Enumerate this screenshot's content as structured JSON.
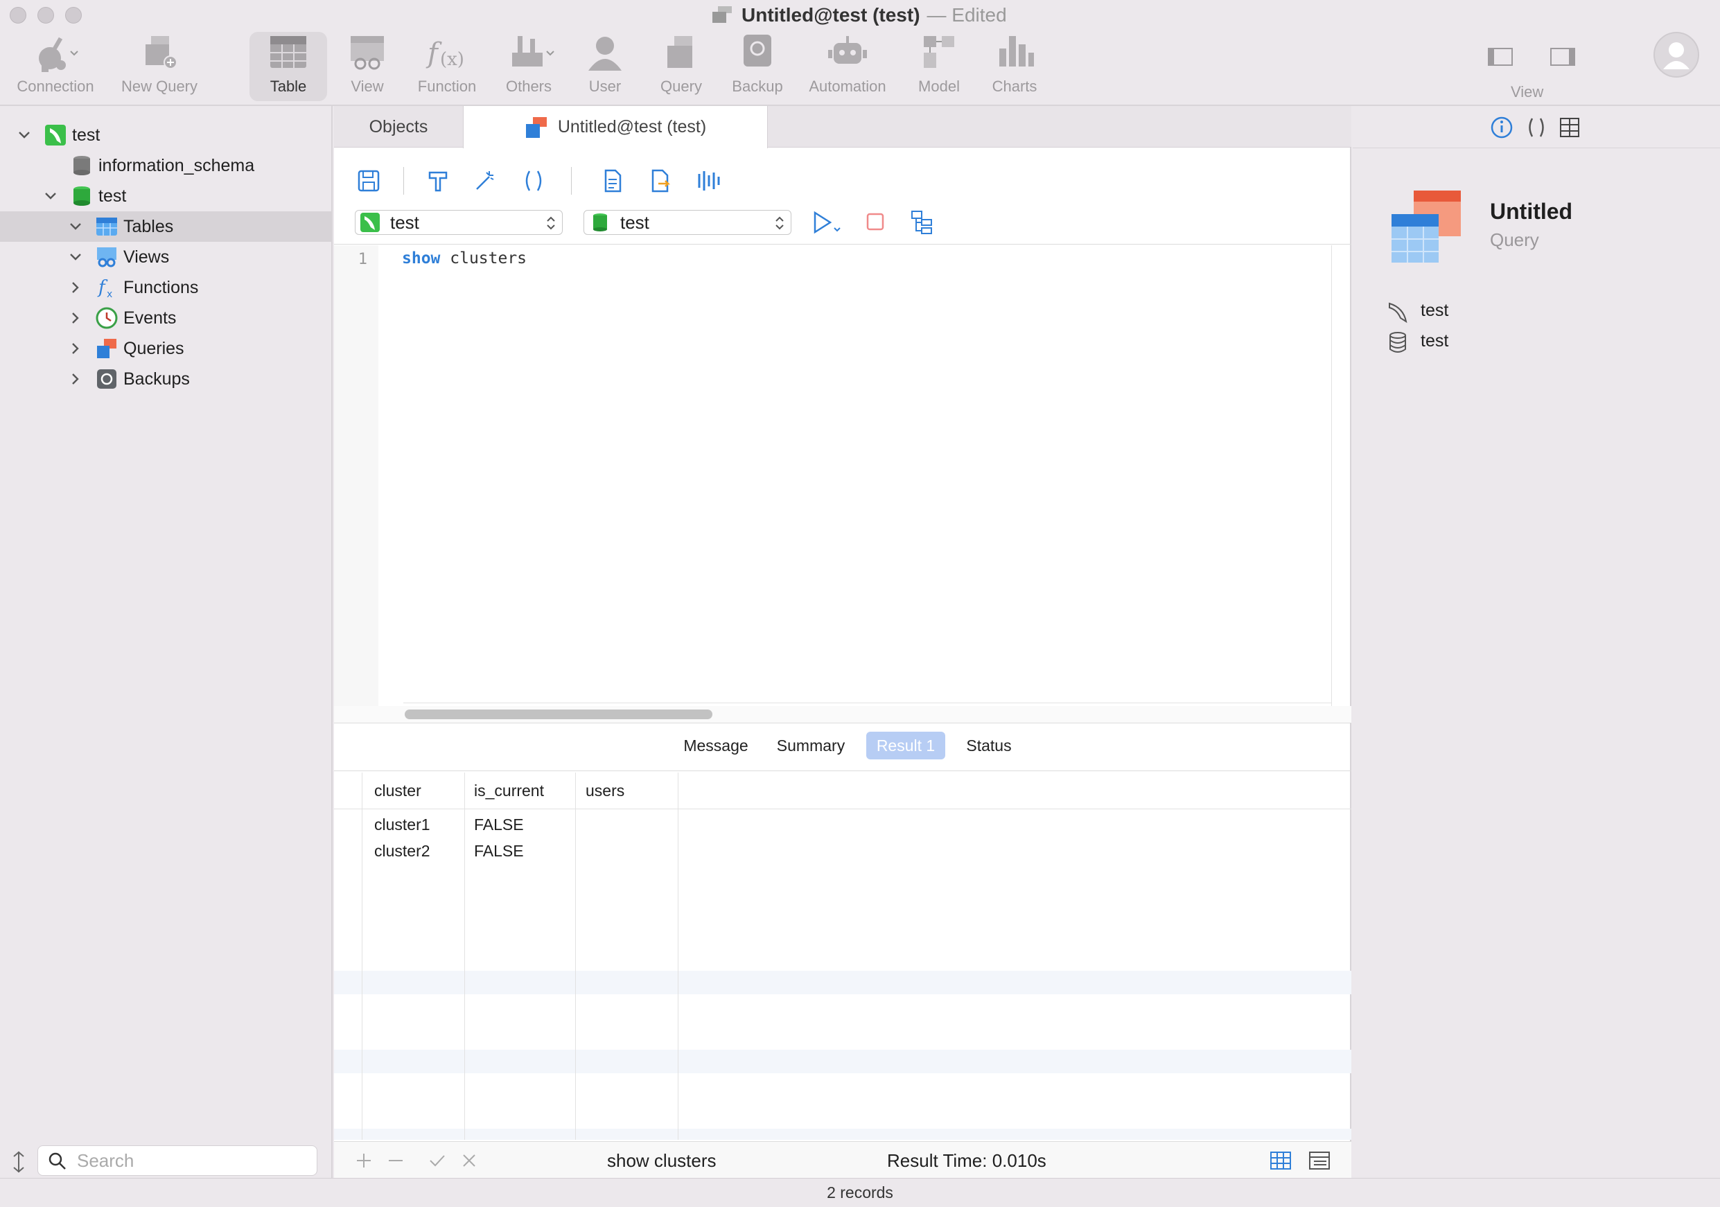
{
  "window": {
    "title": "Untitled@test (test)",
    "edited": "— Edited"
  },
  "toolbar": {
    "items": [
      {
        "label": "Connection",
        "icon": "plug-icon"
      },
      {
        "label": "New Query",
        "icon": "new-query-icon"
      },
      {
        "label": "Table",
        "icon": "table-icon"
      },
      {
        "label": "View",
        "icon": "view-icon"
      },
      {
        "label": "Function",
        "icon": "function-icon"
      },
      {
        "label": "Others",
        "icon": "tools-icon"
      },
      {
        "label": "User",
        "icon": "user-icon"
      },
      {
        "label": "Query",
        "icon": "query-icon"
      },
      {
        "label": "Backup",
        "icon": "backup-icon"
      },
      {
        "label": "Automation",
        "icon": "robot-icon"
      },
      {
        "label": "Model",
        "icon": "model-icon"
      },
      {
        "label": "Charts",
        "icon": "charts-icon"
      }
    ],
    "view_label": "View",
    "active": "Table"
  },
  "sidebar": {
    "tree": [
      {
        "label": "test",
        "icon": "connection-icon"
      },
      {
        "label": "information_schema",
        "icon": "database-grey-icon"
      },
      {
        "label": "test",
        "icon": "database-green-icon"
      },
      {
        "label": "Tables",
        "icon": "tables-icon"
      },
      {
        "label": "Views",
        "icon": "views-icon"
      },
      {
        "label": "Functions",
        "icon": "functions-icon"
      },
      {
        "label": "Events",
        "icon": "events-icon"
      },
      {
        "label": "Queries",
        "icon": "queries-icon"
      },
      {
        "label": "Backups",
        "icon": "backups-icon"
      }
    ],
    "search_placeholder": "Search"
  },
  "tabs": {
    "objects": "Objects",
    "query_tab": "Untitled@test (test)"
  },
  "editor": {
    "connection_select": "test",
    "database_select": "test",
    "line_number": "1",
    "code_keyword": "show",
    "code_rest": "clusters"
  },
  "result_tabs": {
    "message": "Message",
    "summary": "Summary",
    "result1": "Result 1",
    "status": "Status"
  },
  "grid": {
    "columns": [
      "cluster",
      "is_current",
      "users"
    ],
    "rows": [
      [
        "cluster1",
        "FALSE",
        ""
      ],
      [
        "cluster2",
        "FALSE",
        ""
      ]
    ]
  },
  "bottombar": {
    "sql": "show clusters",
    "result_time": "Result Time: 0.010s"
  },
  "rightpanel": {
    "title": "Untitled",
    "subtitle": "Query",
    "connection": "test",
    "database": "test"
  },
  "statusbar": {
    "records": "2 records"
  },
  "colors": {
    "accent_blue": "#2f7fd8",
    "result_tab_active": "#b7cdf4",
    "connection_green": "#3bbf4a"
  }
}
